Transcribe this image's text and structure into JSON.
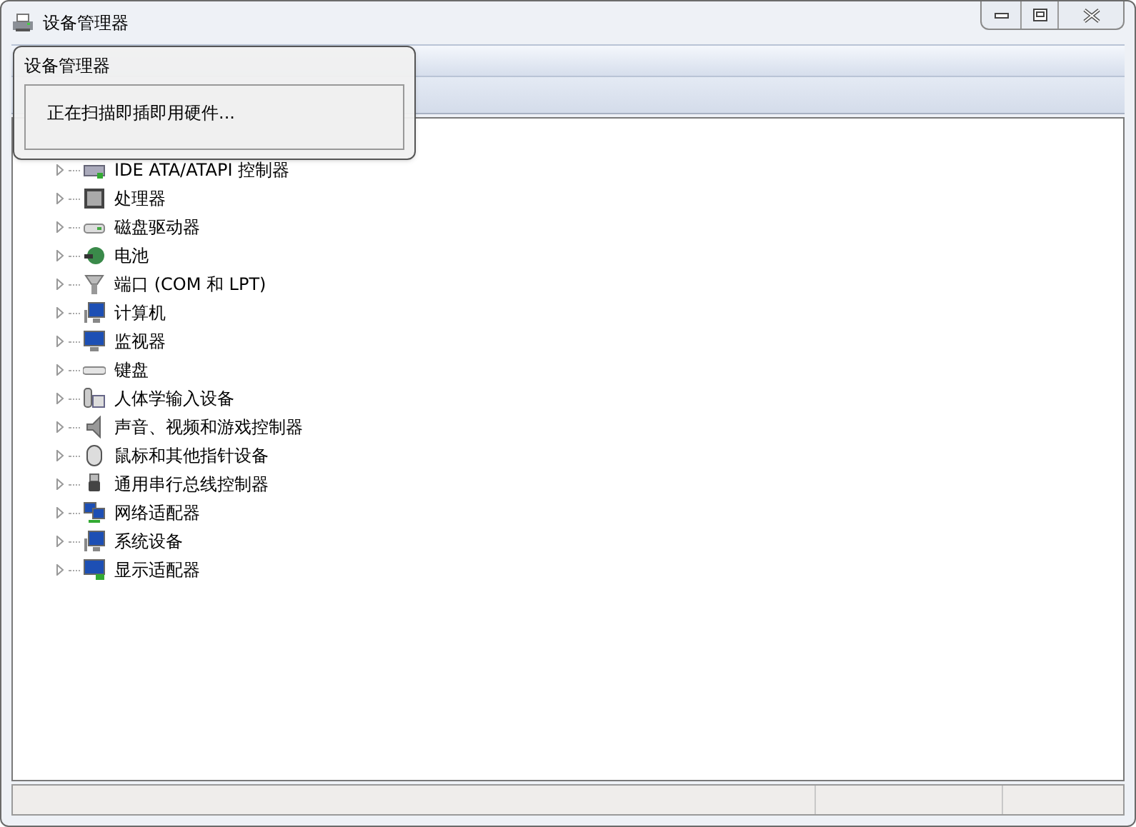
{
  "window": {
    "title": "设备管理器"
  },
  "popup": {
    "title": "设备管理器",
    "message": "正在扫描即插即用硬件..."
  },
  "tree": {
    "items": [
      {
        "label": "IDE ATA/ATAPI 控制器",
        "expanded": false
      },
      {
        "label": "处理器",
        "expanded": false
      },
      {
        "label": "磁盘驱动器",
        "expanded": false
      },
      {
        "label": "电池",
        "expanded": false
      },
      {
        "label": "端口 (COM 和 LPT)",
        "expanded": false
      },
      {
        "label": "计算机",
        "expanded": false
      },
      {
        "label": "监视器",
        "expanded": false
      },
      {
        "label": "键盘",
        "expanded": false
      },
      {
        "label": "人体学输入设备",
        "expanded": false
      },
      {
        "label": "声音、视频和游戏控制器",
        "expanded": false
      },
      {
        "label": "鼠标和其他指针设备",
        "expanded": false
      },
      {
        "label": "通用串行总线控制器",
        "expanded": false
      },
      {
        "label": "网络适配器",
        "expanded": false
      },
      {
        "label": "系统设备",
        "expanded": false
      },
      {
        "label": "显示适配器",
        "expanded": false
      }
    ]
  }
}
